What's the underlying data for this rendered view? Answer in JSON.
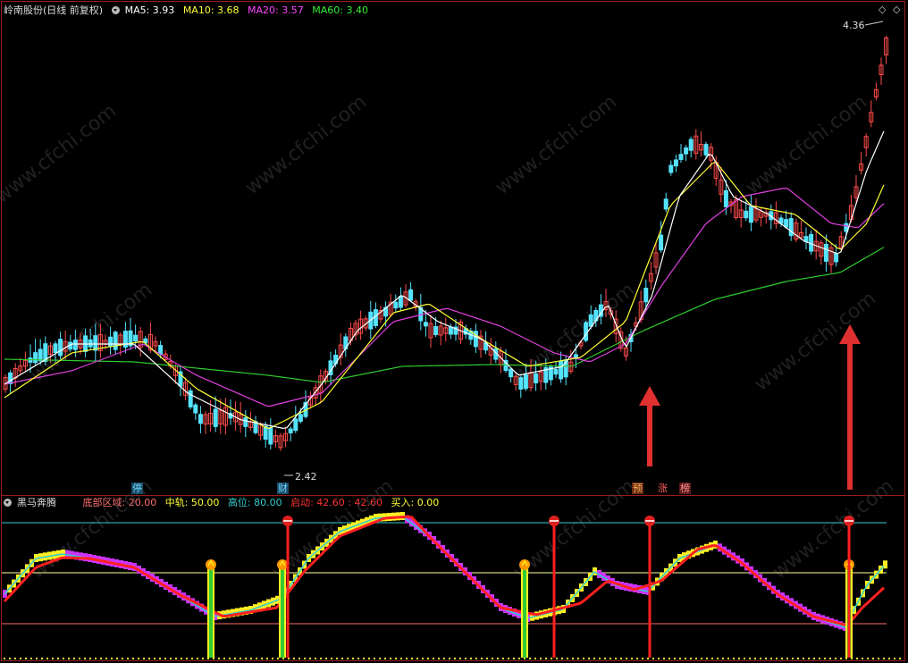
{
  "top_panel": {
    "stock_name": "岭南股份",
    "period": "(日线 前复权)",
    "ma5_label": "MA5: 3.93",
    "ma10_label": "MA10: 3.68",
    "ma20_label": "MA20: 3.57",
    "ma60_label": "MA60: 3.40",
    "high_label": "4.36",
    "low_label": "2.42",
    "colors": {
      "ma5": "#ffffff",
      "ma10": "#ffff33",
      "ma20": "#ff33ff",
      "ma60": "#33ee33",
      "up": "#ff4b4b",
      "down": "#54e3ff"
    }
  },
  "flags": {
    "stop": "停",
    "finance": "财",
    "pre": "预",
    "rise": "涨",
    "list": "榜"
  },
  "bottom_panel": {
    "name": "黑马奔腾",
    "bottom_zone": "底部区域: 20.00",
    "middle": "中轨: 50.00",
    "high": "高位: 80.00",
    "start": "启动: 42.60 : 42.60",
    "buy": "买入: 0.00",
    "colors": {
      "bottom": "#ff6b6b",
      "middle": "#ffff33",
      "high": "#33cccc",
      "start": "#ff3333",
      "buy": "#ffff33"
    }
  },
  "watermark": "www.cfchi.com",
  "icons": [
    "chevron-down-icon",
    "diamond-icon",
    "red-arrow-icon",
    "signal-lamp-icon",
    "signal-ball-icon"
  ]
}
